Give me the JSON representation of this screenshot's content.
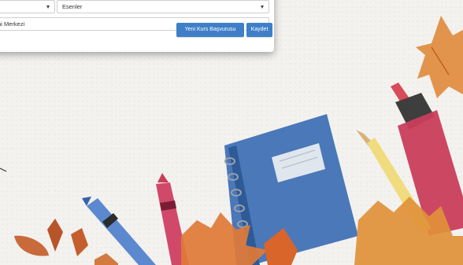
{
  "form": {
    "district_select_value": "Esenler",
    "center_select_value": "mi Merkezi",
    "new_application_button": "Yeni Kurs Başvurusu",
    "save_button": "Kaydet"
  }
}
